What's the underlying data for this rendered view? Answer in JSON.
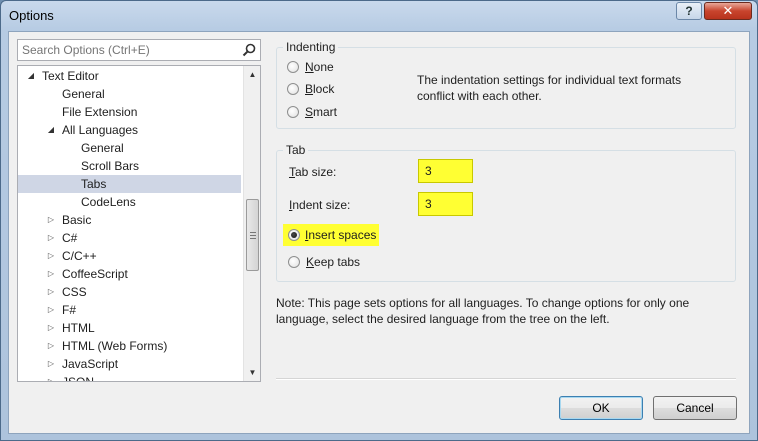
{
  "window": {
    "title": "Options",
    "help_label": "?",
    "close_label": "✕"
  },
  "search": {
    "placeholder": "Search Options (Ctrl+E)"
  },
  "tree": {
    "items": [
      {
        "label": "Text Editor",
        "level": 0,
        "expander": "expanded"
      },
      {
        "label": "General",
        "level": 1,
        "expander": "none"
      },
      {
        "label": "File Extension",
        "level": 1,
        "expander": "none"
      },
      {
        "label": "All Languages",
        "level": 1,
        "expander": "expanded"
      },
      {
        "label": "General",
        "level": 2,
        "expander": "none"
      },
      {
        "label": "Scroll Bars",
        "level": 2,
        "expander": "none"
      },
      {
        "label": "Tabs",
        "level": 2,
        "expander": "none",
        "selected": true
      },
      {
        "label": "CodeLens",
        "level": 2,
        "expander": "none"
      },
      {
        "label": "Basic",
        "level": 1,
        "expander": "collapsed"
      },
      {
        "label": "C#",
        "level": 1,
        "expander": "collapsed"
      },
      {
        "label": "C/C++",
        "level": 1,
        "expander": "collapsed"
      },
      {
        "label": "CoffeeScript",
        "level": 1,
        "expander": "collapsed"
      },
      {
        "label": "CSS",
        "level": 1,
        "expander": "collapsed"
      },
      {
        "label": "F#",
        "level": 1,
        "expander": "collapsed"
      },
      {
        "label": "HTML",
        "level": 1,
        "expander": "collapsed"
      },
      {
        "label": "HTML (Web Forms)",
        "level": 1,
        "expander": "collapsed"
      },
      {
        "label": "JavaScript",
        "level": 1,
        "expander": "collapsed"
      },
      {
        "label": "JSON",
        "level": 1,
        "expander": "collapsed"
      }
    ]
  },
  "indenting": {
    "title": "Indenting",
    "options": [
      {
        "label_first": "N",
        "label_rest": "one",
        "checked": false
      },
      {
        "label_first": "B",
        "label_rest": "lock",
        "checked": false
      },
      {
        "label_first": "S",
        "label_rest": "mart",
        "checked": false
      }
    ],
    "description": "The indentation settings for individual text formats conflict with each other."
  },
  "tab": {
    "title": "Tab",
    "tab_size_label_first": "T",
    "tab_size_label_rest": "ab size:",
    "tab_size_value": "3",
    "indent_size_label_first": "I",
    "indent_size_label_rest": "ndent size:",
    "indent_size_value": "3",
    "insert_spaces_first": "I",
    "insert_spaces_rest": "nsert spaces",
    "insert_spaces_checked": true,
    "keep_tabs_first": "K",
    "keep_tabs_rest": "eep tabs",
    "keep_tabs_checked": false
  },
  "note": "Note: This page sets options for all languages. To change options for only one language, select the desired language from the tree on the left.",
  "buttons": {
    "ok": "OK",
    "cancel": "Cancel"
  },
  "colors": {
    "highlight": "#ffff33",
    "selection": "#cfd6e5",
    "close_button": "#c8442d"
  }
}
